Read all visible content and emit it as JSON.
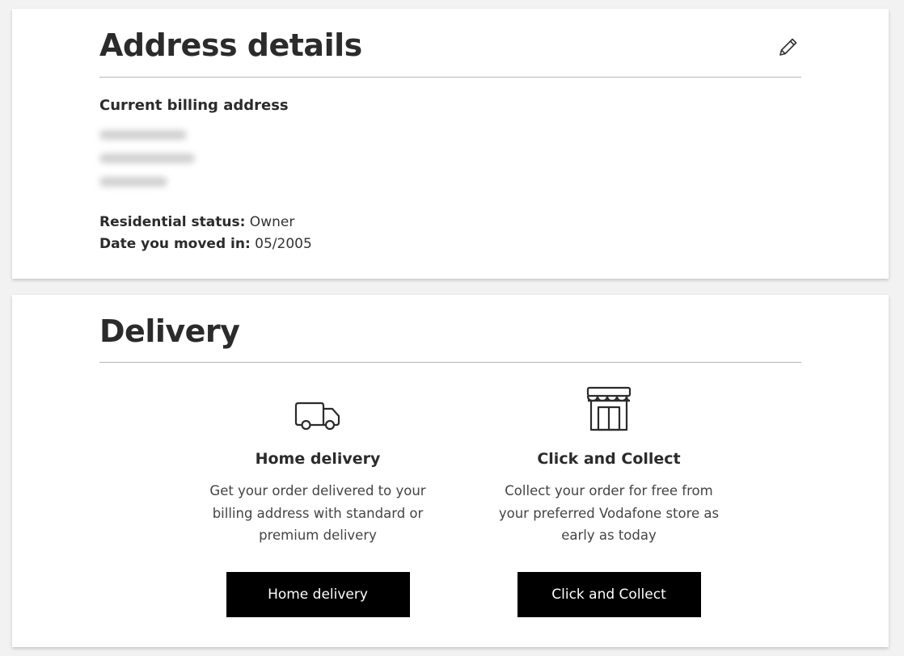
{
  "address_section": {
    "title": "Address details",
    "edit_icon": "pencil-icon",
    "subheading": "Current billing address",
    "residential_status_label": "Residential status:",
    "residential_status_value": " Owner",
    "moved_in_label": "Date you moved in:",
    "moved_in_value": " 05/2005"
  },
  "delivery_section": {
    "title": "Delivery",
    "options": [
      {
        "icon": "truck-icon",
        "title": "Home delivery",
        "description": "Get your order delivered to your billing address with standard or premium delivery",
        "button_label": "Home delivery"
      },
      {
        "icon": "store-icon",
        "title": "Click and Collect",
        "description": "Collect your order for free from your preferred Vodafone store as early as today",
        "button_label": "Click and Collect"
      }
    ]
  },
  "colors": {
    "page_background": "#f2f2f2",
    "card_background": "#ffffff",
    "button_background": "#000000",
    "button_text": "#ffffff"
  }
}
